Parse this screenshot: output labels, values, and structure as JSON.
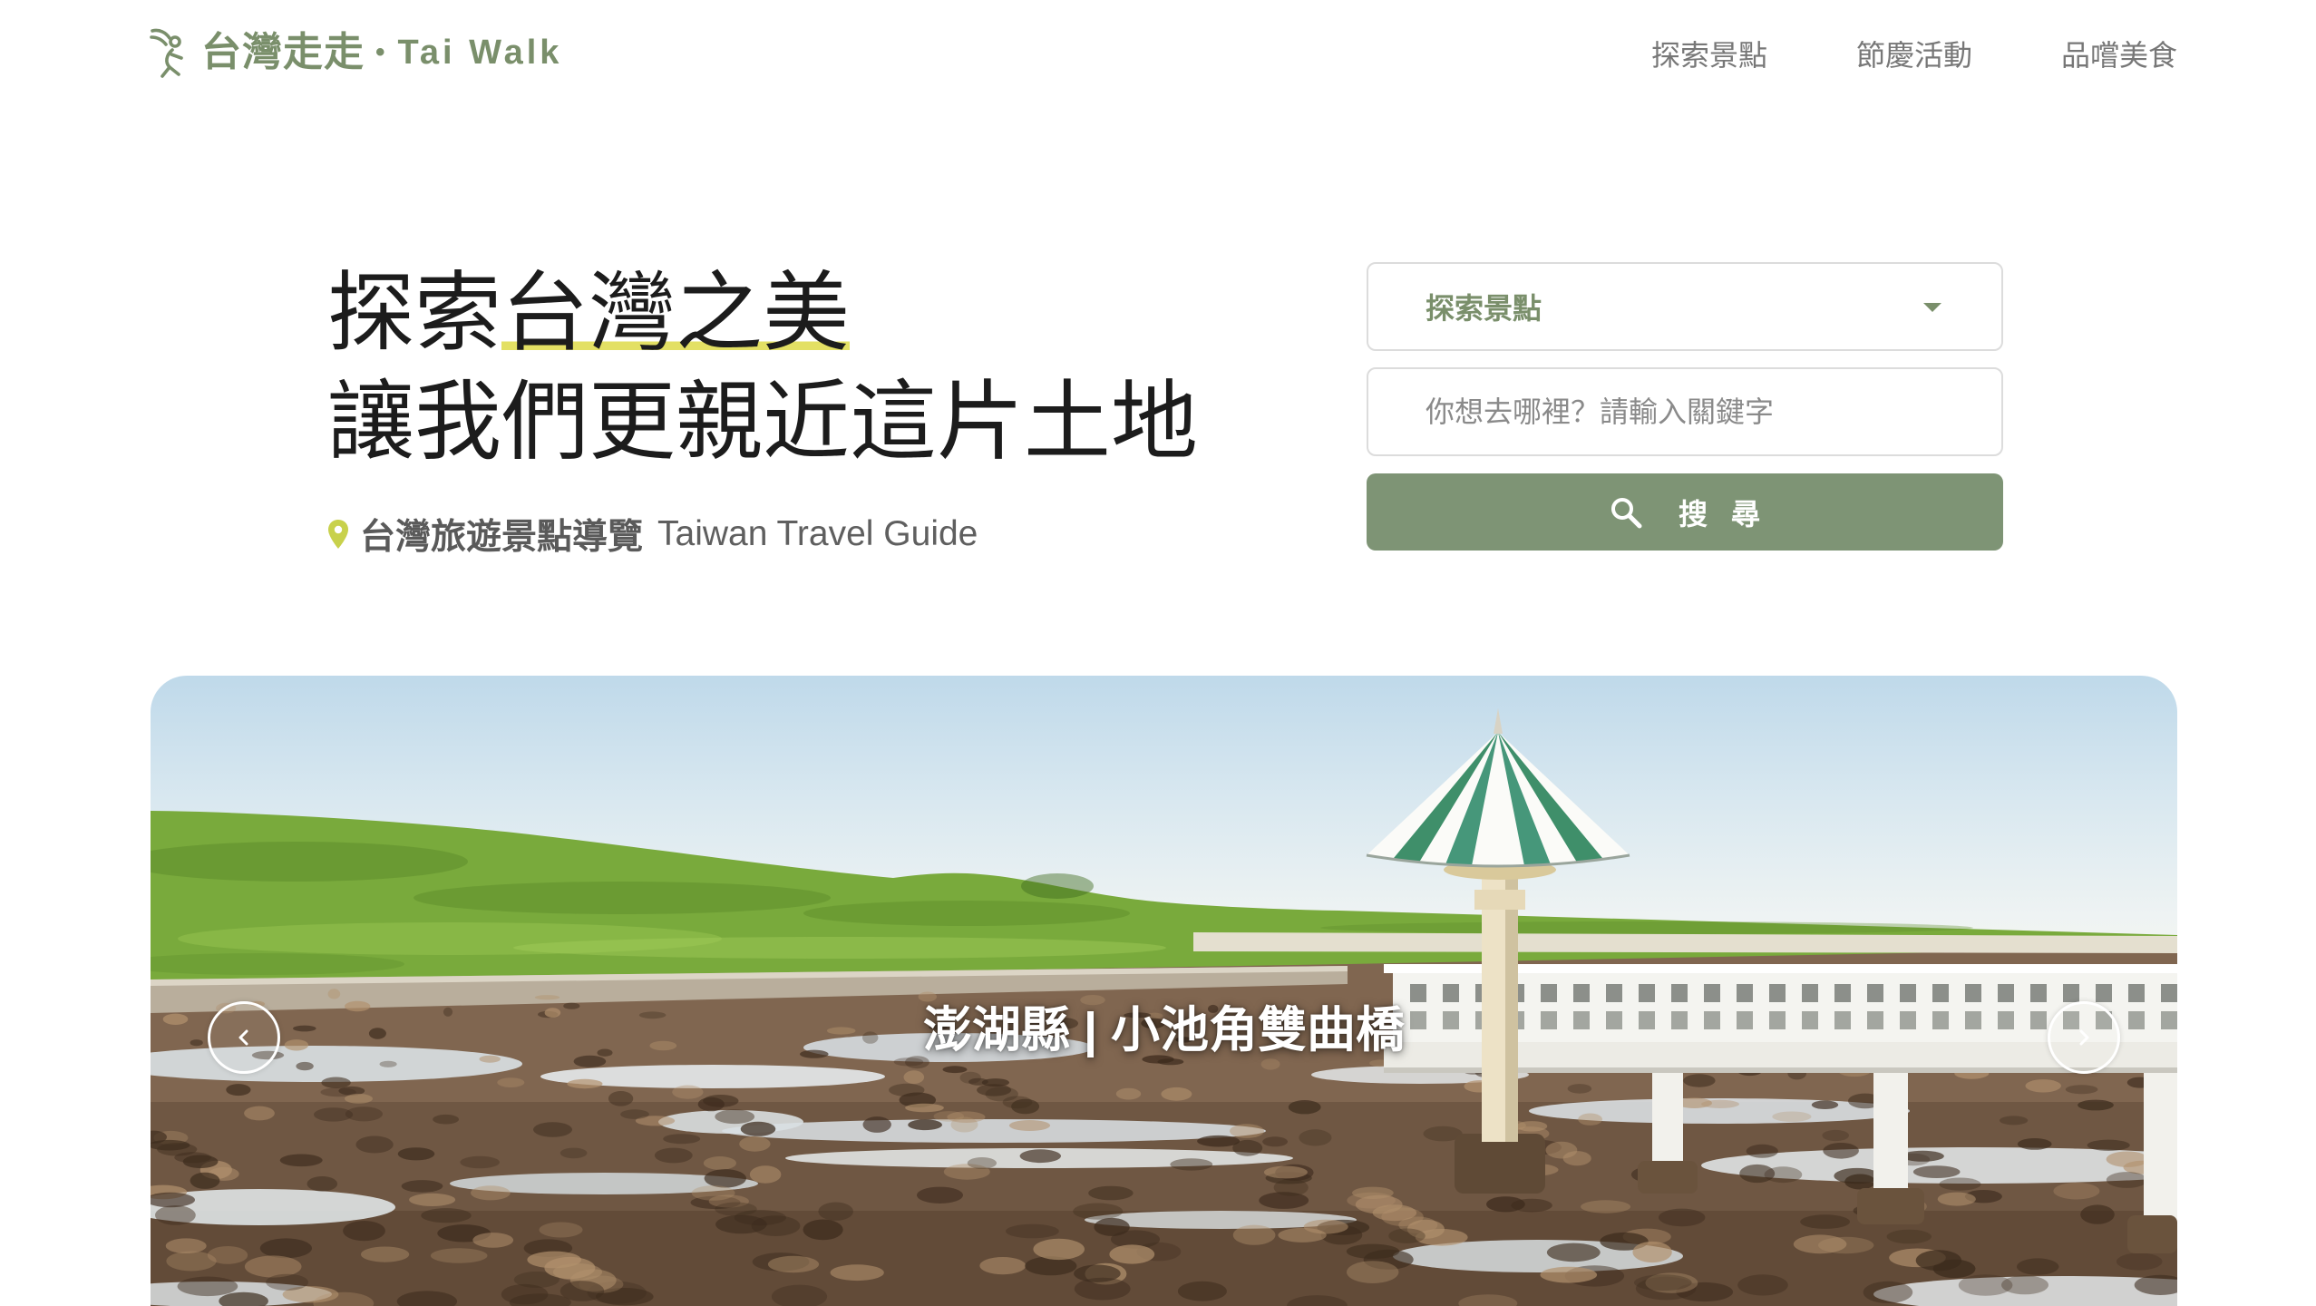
{
  "brand": {
    "name_zh": "台灣走走",
    "separator": "•",
    "name_en": "Tai Walk"
  },
  "nav": [
    {
      "label": "探索景點"
    },
    {
      "label": "節慶活動"
    },
    {
      "label": "品嚐美食"
    }
  ],
  "hero": {
    "line1_prefix": "探索",
    "line1_highlight": "台灣之美",
    "line2": "讓我們更親近這片土地",
    "subtitle_zh": "台灣旅遊景點導覽",
    "subtitle_en": "Taiwan Travel Guide"
  },
  "search": {
    "category_selected": "探索景點",
    "keyword_value": "",
    "keyword_placeholder": "你想去哪裡？請輸入關鍵字",
    "button_label": "搜尋"
  },
  "carousel": {
    "caption": "澎湖縣 | 小池角雙曲橋"
  },
  "icons": {
    "logo": "walker-logo-icon",
    "subtitle": "location-pin-icon",
    "search": "search-icon",
    "select": "caret-down-icon",
    "prev": "chevron-left-icon",
    "next": "chevron-right-icon"
  },
  "colors": {
    "brand": "#7a8f6b",
    "button": "#7e9475",
    "highlight": "#e3e064",
    "pin": "#c8d14c",
    "text-dark": "#1c1c1c",
    "text-gray": "#737373"
  }
}
